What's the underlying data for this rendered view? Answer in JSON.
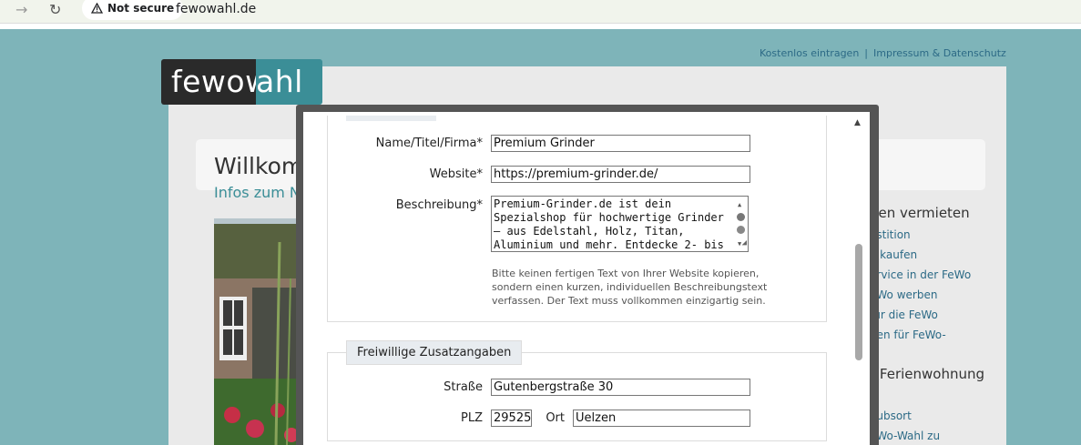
{
  "browser": {
    "security_label": "Not secure",
    "url": "fewowahl.de"
  },
  "site": {
    "logo_part1": "fewow",
    "logo_part2": "ahl",
    "top_links": [
      "Kostenlos eintragen",
      "Impressum & Datenschutz"
    ],
    "welcome": "Willkom",
    "infos": "Infos zum N",
    "right_heading_1": "gen vermieten",
    "right_links": [
      "estition",
      "o kaufen",
      "ervice in der FeWo",
      "eWo werben",
      "für die FeWo",
      "nen für FeWo-"
    ],
    "right_heading_2": "r Ferienwohnung",
    "right_links_2": [
      "?",
      "aubsort",
      "eWo-Wahl zu"
    ]
  },
  "form": {
    "name_label": "Name/Titel/Firma*",
    "name_value": "Premium Grinder",
    "website_label": "Website*",
    "website_value": "https://premium-grinder.de/",
    "description_label": "Beschreibung*",
    "description_value": "Premium-Grinder.de ist dein\nSpezialshop für hochwertige Grinder\n– aus Edelstahl, Holz, Titan,\nAluminium und mehr. Entdecke 2- bis",
    "hint": "Bitte keinen fertigen Text von Ihrer Website kopieren, sondern einen kurzen, individuellen Beschreibungstext verfassen. Der Text muss vollkommen einzigartig sein.",
    "optional_legend": "Freiwillige Zusatzangaben",
    "street_label": "Straße",
    "street_value": "Gutenbergstraße 30",
    "zip_label": "PLZ",
    "zip_value": "29525",
    "city_label": "Ort",
    "city_value": "Uelzen"
  },
  "colors": {
    "page_bg": "#7eb4b9",
    "accent": "#3b8e97",
    "link": "#2c6a86"
  }
}
